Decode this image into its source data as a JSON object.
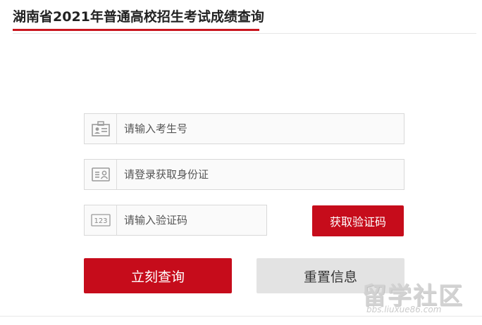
{
  "page": {
    "title": "湖南省2021年普通高校招生考试成绩查询"
  },
  "form": {
    "exam_number": {
      "placeholder": "请输入考生号",
      "icon": "id-card-icon"
    },
    "id_card": {
      "placeholder": "请登录获取身份证",
      "icon": "person-card-icon"
    },
    "captcha": {
      "placeholder": "请输入验证码",
      "icon": "number-123-icon",
      "icon_text": "123"
    },
    "get_code_label": "获取验证码",
    "submit_label": "立刻查询",
    "reset_label": "重置信息"
  },
  "watermark": {
    "main": "留学社区",
    "sub": "bbs.liuxue86.com"
  },
  "colors": {
    "accent": "#c60c1b",
    "underline": "#c9151e",
    "reset_bg": "#e3e3e3",
    "field_border": "#d9d9d9"
  }
}
